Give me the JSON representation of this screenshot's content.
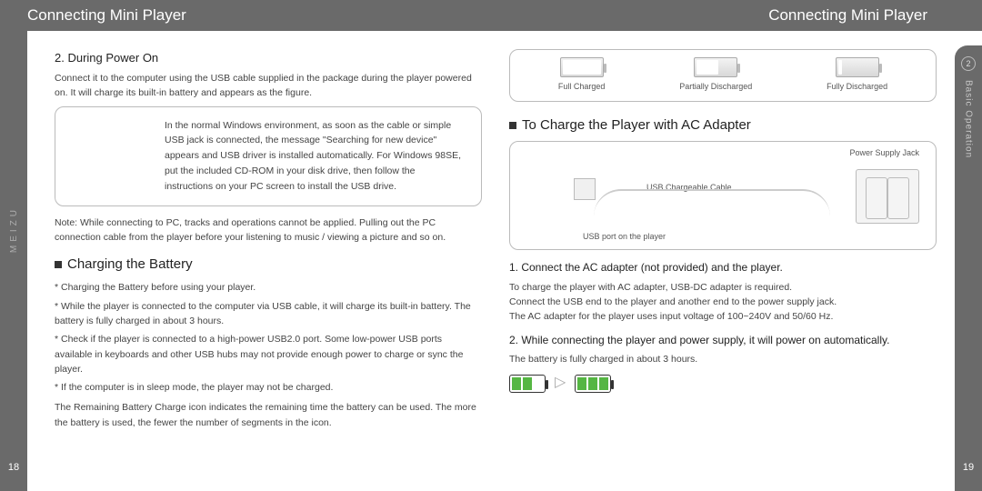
{
  "topbar": {
    "title_left": "Connecting Mini Player",
    "title_right": "Connecting Mini Player"
  },
  "sidebar_left": {
    "brand": "MEIZU",
    "page": "18"
  },
  "sidebar_right": {
    "chapter_num": "2",
    "chapter_label": "Basic Operation",
    "page": "19"
  },
  "left": {
    "poweron_title": "2. During Power On",
    "poweron_desc": "Connect it to the computer using the USB cable supplied in the package during the player powered on. It will charge its built-in battery and appears as the figure.",
    "framed": "In the normal Windows environment, as soon as the cable or simple USB jack is connected, the message \"Searching for new device\" appears and USB driver is installed automatically. For Windows 98SE, put the included CD-ROM in your disk drive, then follow the instructions on your PC screen to install the USB drive.",
    "note": "Note: While connecting to PC, tracks and operations cannot be applied. Pulling out the PC connection cable from the player before your listening to music / viewing a picture and so on.",
    "charging_title": "Charging the Battery",
    "b1": "* Charging the Battery before using your player.",
    "b2": "* While the player is connected to the computer via USB cable, it will charge its built-in battery. The battery is fully charged in about 3 hours.",
    "b3": "* Check if the player is connected to a high-power USB2.0 port. Some low-power USB ports available in keyboards and other USB hubs may not provide enough power to charge or sync the player.",
    "b4": "* If the computer is in sleep mode, the player may not be charged.",
    "remaining": "The Remaining Battery Charge icon indicates the remaining time the battery can be used. The more the battery is used, the fewer the number of segments in the icon."
  },
  "right": {
    "status": {
      "full": "Full Charged",
      "partial": "Partially Discharged",
      "empty": "Fully Discharged"
    },
    "ac_title": "To Charge the Player with AC Adapter",
    "diagram": {
      "psj": "Power Supply Jack",
      "cable": "USB Chargeable Cable",
      "port": "USB port on the player"
    },
    "step1_title": "1. Connect the AC adapter (not provided) and the player.",
    "step1_a": "To charge the player with AC adapter, USB-DC adapter is required.",
    "step1_b": "Connect the USB end to the player and another end to the power supply jack.",
    "step1_c": "The AC adapter for the player uses input voltage of 100~240V and 50/60 Hz.",
    "step2_title": "2. While connecting the player and power supply, it will power on automatically.",
    "step2_a": "The battery is fully charged in about 3 hours."
  }
}
